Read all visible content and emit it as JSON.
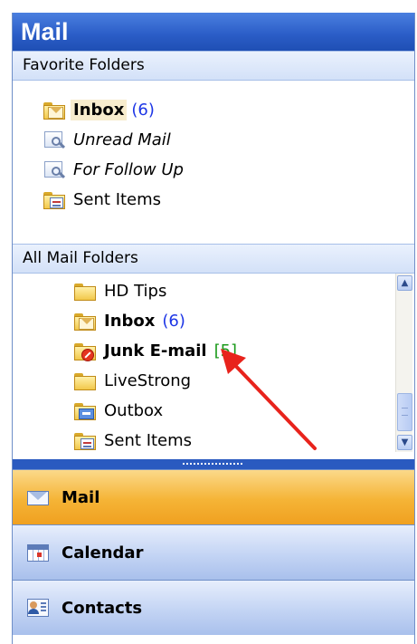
{
  "header": {
    "title": "Mail"
  },
  "favorites": {
    "label": "Favorite Folders",
    "items": [
      {
        "name": "Inbox",
        "count": "(6)"
      },
      {
        "name": "Unread Mail"
      },
      {
        "name": "For Follow Up"
      },
      {
        "name": "Sent Items"
      }
    ]
  },
  "all_folders": {
    "label": "All Mail Folders",
    "items": [
      {
        "name": "HD Tips"
      },
      {
        "name": "Inbox",
        "count": "(6)"
      },
      {
        "name": "Junk E-mail",
        "count": "[5]"
      },
      {
        "name": "LiveStrong"
      },
      {
        "name": "Outbox"
      },
      {
        "name": "Sent Items"
      }
    ]
  },
  "nav": {
    "mail": "Mail",
    "calendar": "Calendar",
    "contacts": "Contacts"
  },
  "colors": {
    "header_blue": "#2a5cc6",
    "count_blue": "#1d36e6",
    "count_green": "#1a9a1a",
    "selection": "#f7eccd",
    "active_nav": "#f5b436",
    "annotation_arrow": "#e8231c"
  }
}
